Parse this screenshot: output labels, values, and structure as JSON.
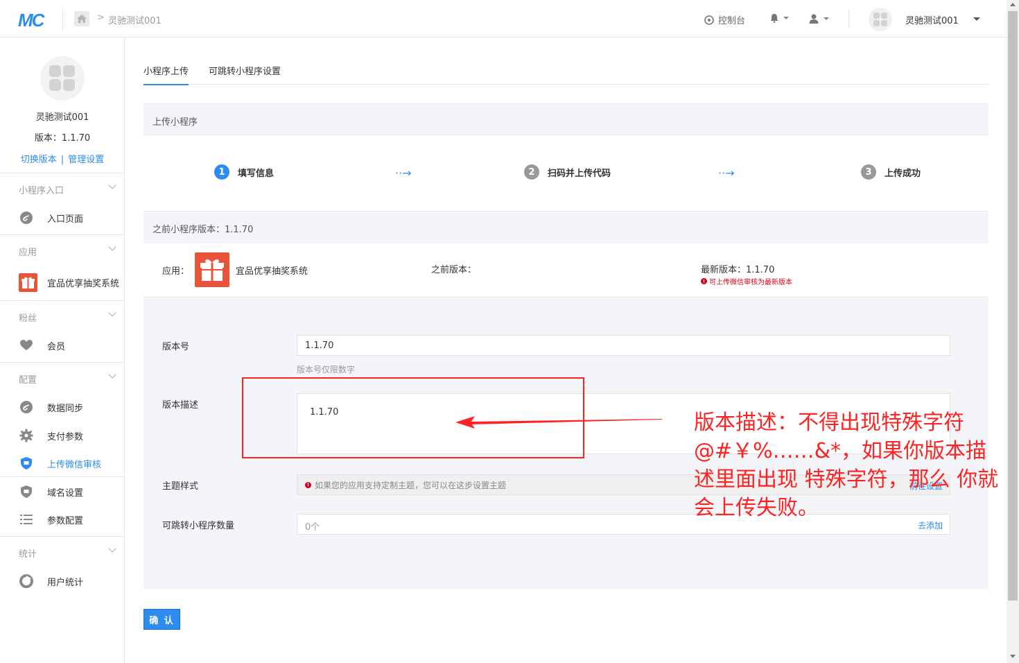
{
  "topbar": {
    "logo": "MC",
    "breadcrumb": "灵驰测试001",
    "console": "控制台",
    "account": "灵驰测试001"
  },
  "sidebar": {
    "app_name": "灵驰测试001",
    "version": "版本：1.1.70",
    "switch_version": "切换版本",
    "link_sep": "|",
    "manage": "管理设置",
    "sections": [
      {
        "title": "小程序入口",
        "items": [
          {
            "label": "入口页面",
            "icon": "link-icon"
          }
        ]
      },
      {
        "title": "应用",
        "items": [
          {
            "label": "宜品优享抽奖系统",
            "icon": "gift-icon"
          }
        ]
      },
      {
        "title": "粉丝",
        "items": [
          {
            "label": "会员",
            "icon": "heart-icon"
          }
        ]
      },
      {
        "title": "配置",
        "items": [
          {
            "label": "数据同步",
            "icon": "link-icon"
          },
          {
            "label": "支付参数",
            "icon": "gear-icon"
          },
          {
            "label": "上传微信审核",
            "icon": "shield-icon",
            "active": true
          },
          {
            "label": "域名设置",
            "icon": "shield-icon"
          },
          {
            "label": "参数配置",
            "icon": "list-icon"
          }
        ]
      },
      {
        "title": "统计",
        "items": [
          {
            "label": "用户统计",
            "icon": "pie-icon"
          }
        ]
      }
    ]
  },
  "main": {
    "tabs": [
      "小程序上传",
      "可跳转小程序设置"
    ],
    "upload_title": "上传小程序",
    "steps": [
      {
        "num": "1",
        "label": "填写信息"
      },
      {
        "num": "2",
        "label": "扫码并上传代码"
      },
      {
        "num": "3",
        "label": "上传成功"
      }
    ],
    "prev_title": "之前小程序版本：1.1.70",
    "app_label": "应用：",
    "app_value": "宜品优享抽奖系统",
    "prev_version_label": "之前版本：",
    "latest_version": "最新版本：1.1.70",
    "latest_warn": "可上传微信审核为最新版本",
    "form": {
      "version_label": "版本号",
      "version_value": "1.1.70",
      "version_hint": "版本号仅限数字",
      "desc_label": "版本描述",
      "desc_value": "1.1.70",
      "theme_label": "主题样式",
      "theme_hint": "如果您的应用支持定制主题，您可以在这步设置主题",
      "theme_link": "前往设置",
      "jump_label": "可跳转小程序数量",
      "jump_value": "0个",
      "jump_link": "去添加"
    },
    "confirm": "确 认"
  },
  "annotation": {
    "text": "版本描述：不得出现特殊字符 @#￥%……&*，如果你版本描述里面出现 特殊字符，那么 你就会上传失败。",
    "color": "#ff2222"
  }
}
